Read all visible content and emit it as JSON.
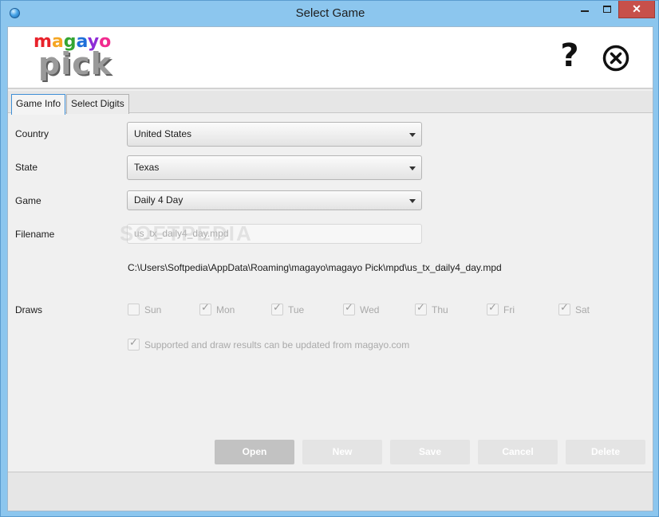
{
  "window": {
    "title": "Select Game",
    "minimize_icon": "minimize-icon",
    "maximize_icon": "maximize-icon",
    "close_glyph": "✕"
  },
  "header": {
    "logo_top": "magayo",
    "logo_bottom": "pick",
    "logo_colors": [
      "#e8222b",
      "#f5a623",
      "#33a532",
      "#1e6fd9",
      "#8e2bd6",
      "#f12b8f"
    ],
    "help_glyph": "?",
    "close_icon": "close-circle-icon"
  },
  "tabs": [
    {
      "label": "Game Info",
      "active": true
    },
    {
      "label": "Select Digits",
      "active": false
    }
  ],
  "form": {
    "country": {
      "label": "Country",
      "value": "United States"
    },
    "state": {
      "label": "State",
      "value": "Texas"
    },
    "game": {
      "label": "Game",
      "value": "Daily 4 Day"
    },
    "filename": {
      "label": "Filename",
      "value": "us_tx_daily4_day.mpd"
    },
    "path": "C:\\Users\\Softpedia\\AppData\\Roaming\\magayo\\magayo Pick\\mpd\\us_tx_daily4_day.mpd",
    "draws_label": "Draws",
    "days": [
      {
        "label": "Sun",
        "checked": false
      },
      {
        "label": "Mon",
        "checked": true
      },
      {
        "label": "Tue",
        "checked": true
      },
      {
        "label": "Wed",
        "checked": true
      },
      {
        "label": "Thu",
        "checked": true
      },
      {
        "label": "Fri",
        "checked": true
      },
      {
        "label": "Sat",
        "checked": true
      }
    ],
    "supported": {
      "label": "Supported and draw results can be updated from magayo.com",
      "checked": true
    }
  },
  "watermark": "SOFTPEDIA",
  "buttons": {
    "open": "Open",
    "new": "New",
    "save": "Save",
    "cancel": "Cancel",
    "delete": "Delete"
  }
}
